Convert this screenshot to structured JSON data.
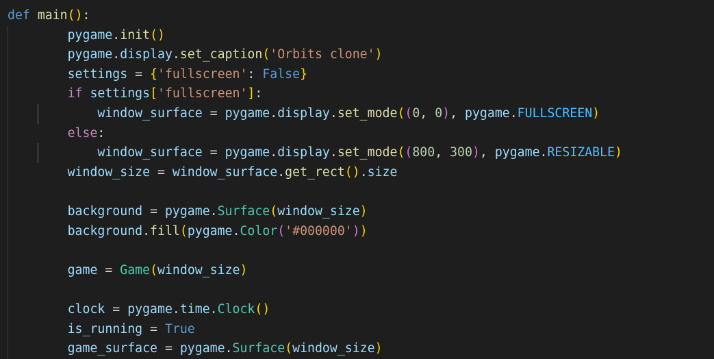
{
  "editor": {
    "theme": {
      "background": "#1e1e1e",
      "keyword": "#569cd6",
      "control": "#c586c0",
      "function": "#dcdcaa",
      "variable": "#9cdcfe",
      "class": "#4ec9b0",
      "string": "#ce9178",
      "number": "#b5cea8",
      "bracket_1": "#ffd700",
      "bracket_2": "#da70d6",
      "bracket_3": "#179fff"
    },
    "lines": [
      {
        "indent": 0,
        "text": "def main():",
        "tokens": [
          [
            "kw",
            "def"
          ],
          [
            "op",
            " "
          ],
          [
            "fn",
            "main"
          ],
          [
            "b1",
            "()"
          ],
          [
            "op",
            ":"
          ]
        ]
      },
      {
        "indent": 2,
        "text": "pygame.init()",
        "tokens": [
          [
            "var",
            "pygame"
          ],
          [
            "op",
            "."
          ],
          [
            "fn",
            "init"
          ],
          [
            "b1",
            "()"
          ]
        ]
      },
      {
        "indent": 2,
        "text": "pygame.display.set_caption('Orbits clone')",
        "tokens": [
          [
            "var",
            "pygame"
          ],
          [
            "op",
            "."
          ],
          [
            "var",
            "display"
          ],
          [
            "op",
            "."
          ],
          [
            "fn",
            "set_caption"
          ],
          [
            "b1",
            "("
          ],
          [
            "str",
            "'Orbits clone'"
          ],
          [
            "b1",
            ")"
          ]
        ]
      },
      {
        "indent": 2,
        "text": "settings = {'fullscreen': False}",
        "tokens": [
          [
            "var",
            "settings"
          ],
          [
            "op",
            " = "
          ],
          [
            "b1",
            "{"
          ],
          [
            "str",
            "'fullscreen'"
          ],
          [
            "op",
            ": "
          ],
          [
            "kw",
            "False"
          ],
          [
            "b1",
            "}"
          ]
        ]
      },
      {
        "indent": 2,
        "text": "if settings['fullscreen']:",
        "tokens": [
          [
            "ctrl",
            "if"
          ],
          [
            "op",
            " "
          ],
          [
            "var",
            "settings"
          ],
          [
            "b1",
            "["
          ],
          [
            "str",
            "'fullscreen'"
          ],
          [
            "b1",
            "]"
          ],
          [
            "op",
            ":"
          ]
        ]
      },
      {
        "indent": 3,
        "text": "window_surface = pygame.display.set_mode((0, 0), pygame.FULLSCREEN)",
        "tokens": [
          [
            "var",
            "window_surface"
          ],
          [
            "op",
            " = "
          ],
          [
            "var",
            "pygame"
          ],
          [
            "op",
            "."
          ],
          [
            "var",
            "display"
          ],
          [
            "op",
            "."
          ],
          [
            "fn",
            "set_mode"
          ],
          [
            "b1",
            "("
          ],
          [
            "b2",
            "("
          ],
          [
            "num",
            "0"
          ],
          [
            "op",
            ", "
          ],
          [
            "num",
            "0"
          ],
          [
            "b2",
            ")"
          ],
          [
            "op",
            ", "
          ],
          [
            "var",
            "pygame"
          ],
          [
            "op",
            "."
          ],
          [
            "const",
            "FULLSCREEN"
          ],
          [
            "b1",
            ")"
          ]
        ]
      },
      {
        "indent": 2,
        "text": "else:",
        "tokens": [
          [
            "ctrl",
            "else"
          ],
          [
            "op",
            ":"
          ]
        ]
      },
      {
        "indent": 3,
        "text": "window_surface = pygame.display.set_mode((800, 300), pygame.RESIZABLE)",
        "tokens": [
          [
            "var",
            "window_surface"
          ],
          [
            "op",
            " = "
          ],
          [
            "var",
            "pygame"
          ],
          [
            "op",
            "."
          ],
          [
            "var",
            "display"
          ],
          [
            "op",
            "."
          ],
          [
            "fn",
            "set_mode"
          ],
          [
            "b1",
            "("
          ],
          [
            "b2",
            "("
          ],
          [
            "num",
            "800"
          ],
          [
            "op",
            ", "
          ],
          [
            "num",
            "300"
          ],
          [
            "b2",
            ")"
          ],
          [
            "op",
            ", "
          ],
          [
            "var",
            "pygame"
          ],
          [
            "op",
            "."
          ],
          [
            "const",
            "RESIZABLE"
          ],
          [
            "b1",
            ")"
          ]
        ]
      },
      {
        "indent": 2,
        "text": "window_size = window_surface.get_rect().size",
        "tokens": [
          [
            "var",
            "window_size"
          ],
          [
            "op",
            " = "
          ],
          [
            "var",
            "window_surface"
          ],
          [
            "op",
            "."
          ],
          [
            "fn",
            "get_rect"
          ],
          [
            "b1",
            "()"
          ],
          [
            "op",
            "."
          ],
          [
            "var",
            "size"
          ]
        ]
      },
      {
        "indent": 2,
        "text": "",
        "tokens": []
      },
      {
        "indent": 2,
        "text": "background = pygame.Surface(window_size)",
        "tokens": [
          [
            "var",
            "background"
          ],
          [
            "op",
            " = "
          ],
          [
            "var",
            "pygame"
          ],
          [
            "op",
            "."
          ],
          [
            "cls",
            "Surface"
          ],
          [
            "b1",
            "("
          ],
          [
            "var",
            "window_size"
          ],
          [
            "b1",
            ")"
          ]
        ]
      },
      {
        "indent": 2,
        "text": "background.fill(pygame.Color('#000000'))",
        "tokens": [
          [
            "var",
            "background"
          ],
          [
            "op",
            "."
          ],
          [
            "fn",
            "fill"
          ],
          [
            "b1",
            "("
          ],
          [
            "var",
            "pygame"
          ],
          [
            "op",
            "."
          ],
          [
            "cls",
            "Color"
          ],
          [
            "b2",
            "("
          ],
          [
            "str",
            "'#000000'"
          ],
          [
            "b2",
            ")"
          ],
          [
            "b1",
            ")"
          ]
        ]
      },
      {
        "indent": 2,
        "text": "",
        "tokens": []
      },
      {
        "indent": 2,
        "text": "game = Game(window_size)",
        "tokens": [
          [
            "var",
            "game"
          ],
          [
            "op",
            " = "
          ],
          [
            "cls",
            "Game"
          ],
          [
            "b1",
            "("
          ],
          [
            "var",
            "window_size"
          ],
          [
            "b1",
            ")"
          ]
        ]
      },
      {
        "indent": 2,
        "text": "",
        "tokens": []
      },
      {
        "indent": 2,
        "text": "clock = pygame.time.Clock()",
        "tokens": [
          [
            "var",
            "clock"
          ],
          [
            "op",
            " = "
          ],
          [
            "var",
            "pygame"
          ],
          [
            "op",
            "."
          ],
          [
            "var",
            "time"
          ],
          [
            "op",
            "."
          ],
          [
            "cls",
            "Clock"
          ],
          [
            "b1",
            "()"
          ]
        ]
      },
      {
        "indent": 2,
        "text": "is_running = True",
        "tokens": [
          [
            "var",
            "is_running"
          ],
          [
            "op",
            " = "
          ],
          [
            "kw",
            "True"
          ]
        ]
      },
      {
        "indent": 2,
        "text": "game_surface = pygame.Surface(window_size)",
        "tokens": [
          [
            "var",
            "game_surface"
          ],
          [
            "op",
            " = "
          ],
          [
            "var",
            "pygame"
          ],
          [
            "op",
            "."
          ],
          [
            "cls",
            "Surface"
          ],
          [
            "b1",
            "("
          ],
          [
            "var",
            "window_size"
          ],
          [
            "b1",
            ")"
          ]
        ]
      }
    ]
  }
}
